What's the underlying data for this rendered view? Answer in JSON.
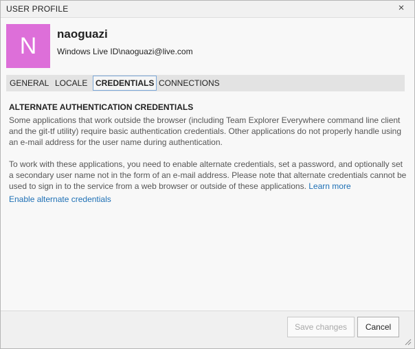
{
  "window": {
    "title": "USER PROFILE",
    "close_glyph": "×"
  },
  "profile": {
    "avatar_letter": "N",
    "avatar_color": "#dd6fd9",
    "name": "naoguazi",
    "live_id": "Windows Live ID\\naoguazi@live.com"
  },
  "tabs": [
    {
      "label": "GENERAL",
      "active": false
    },
    {
      "label": "LOCALE",
      "active": false
    },
    {
      "label": "CREDENTIALS",
      "active": true
    },
    {
      "label": "CONNECTIONS",
      "active": false
    }
  ],
  "credentials": {
    "heading": "ALTERNATE AUTHENTICATION CREDENTIALS",
    "paragraph1": "Some applications that work outside the browser (including Team Explorer Everywhere command line client and the git-tf utility) require basic authentication credentials. Other applications do not properly handle using an e-mail address for the user name during authentication.",
    "paragraph2": "To work with these applications, you need to enable alternate credentials, set a password, and optionally set a secondary user name not in the form of an e-mail address. Please note that alternate credentials cannot be used to sign in to the service from a web browser or outside of these applications.",
    "learn_more": "Learn more",
    "enable_link": "Enable alternate credentials"
  },
  "footer": {
    "save_label": "Save changes",
    "save_enabled": false,
    "cancel_label": "Cancel"
  },
  "colors": {
    "link": "#1e70b5",
    "active_tab_border": "#7aa7d8"
  }
}
